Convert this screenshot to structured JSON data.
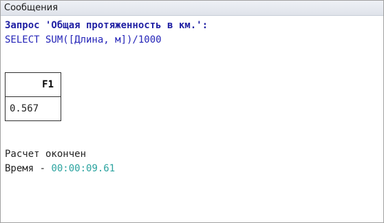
{
  "window": {
    "title": "Сообщения"
  },
  "query": {
    "title_line": "Запрос 'Общая протяженность в км.':",
    "sql": "SELECT SUM([Длина, м])/1000"
  },
  "result_table": {
    "columns": [
      "F1"
    ],
    "rows": [
      [
        "0.567"
      ]
    ]
  },
  "status": {
    "done_text": "Расчет окончен",
    "time_label": "Время - ",
    "time_value": "00:00:09.61"
  },
  "colors": {
    "query_title": "#1f1fa3",
    "query_sql": "#2424b8",
    "time_value": "#2aa39f"
  }
}
